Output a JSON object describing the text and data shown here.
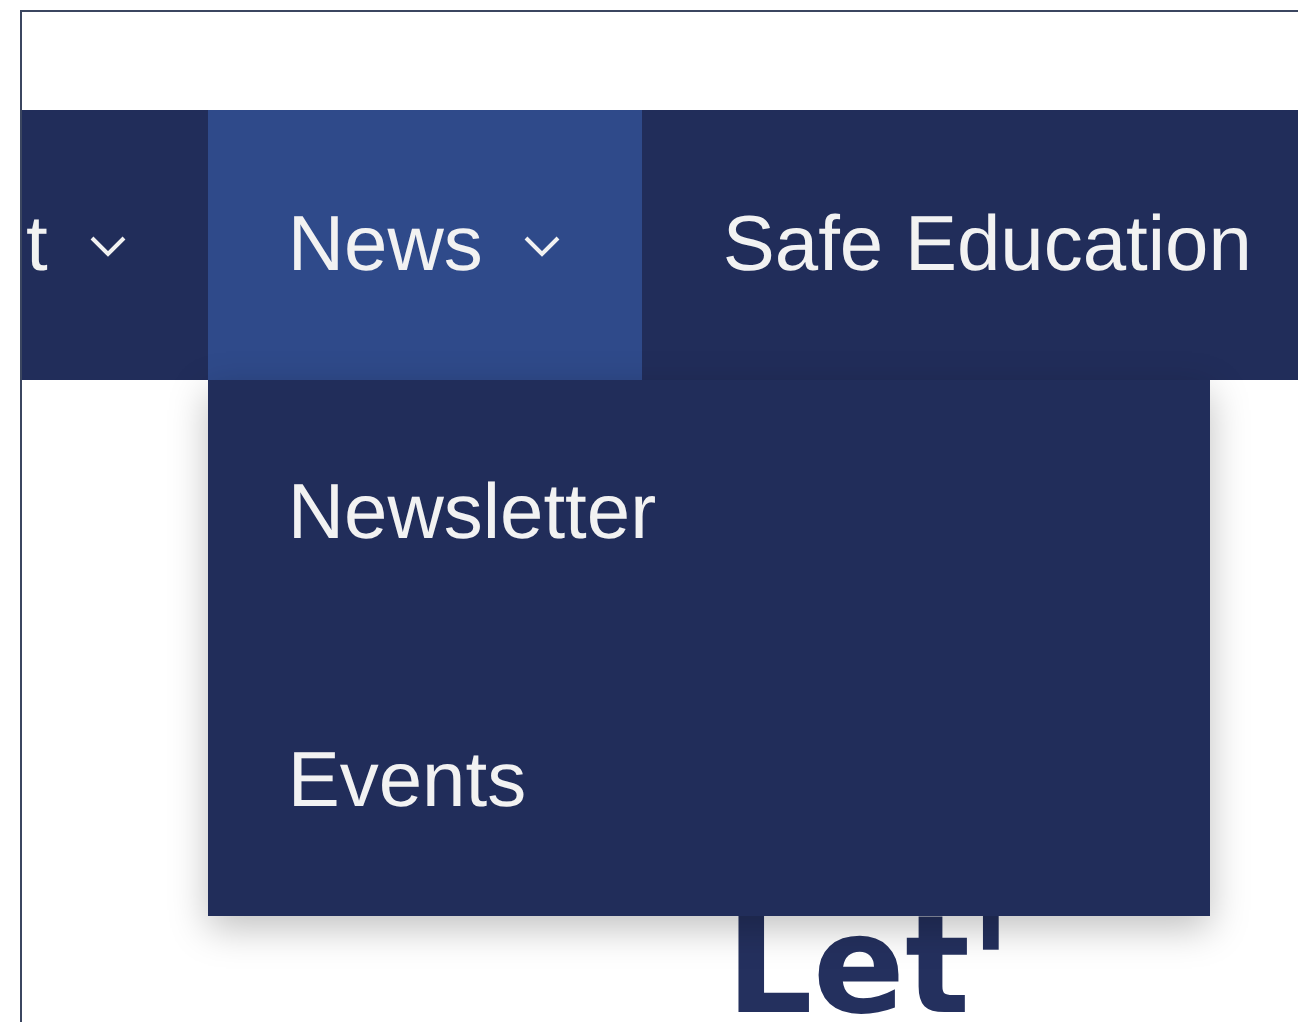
{
  "nav": {
    "items": [
      {
        "label": "t",
        "selected": false,
        "has_submenu": true
      },
      {
        "label": "News",
        "selected": true,
        "has_submenu": true,
        "expanded": true,
        "children": [
          {
            "label": "Newsletter"
          },
          {
            "label": "Events"
          }
        ]
      },
      {
        "label": "Safe Education",
        "selected": false,
        "has_submenu": false
      }
    ]
  },
  "heading": "Let'"
}
